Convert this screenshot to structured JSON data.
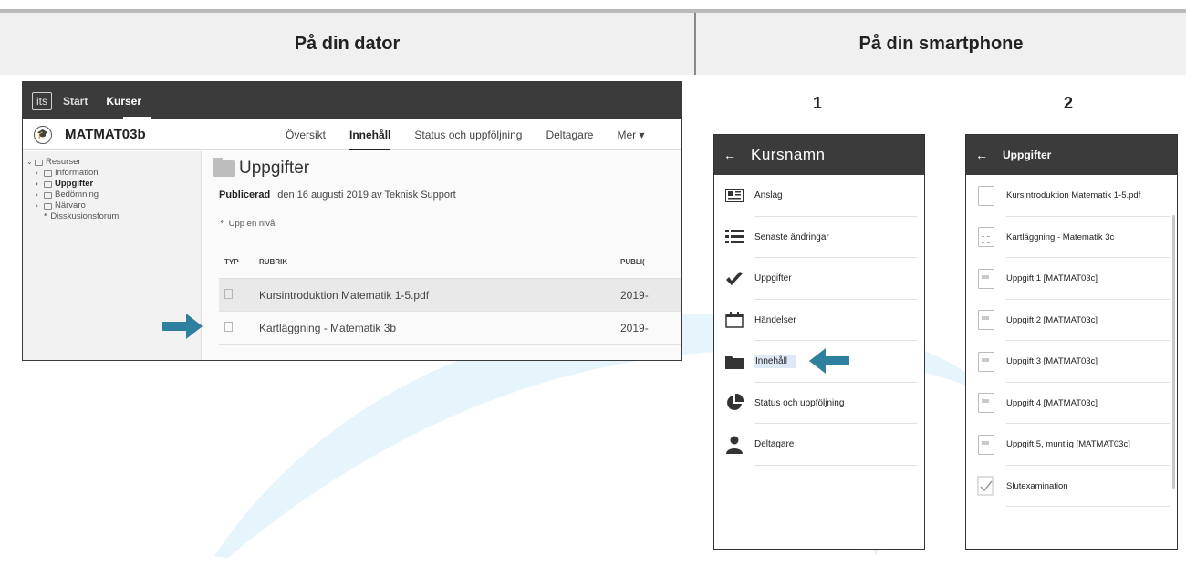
{
  "headers": {
    "left": "På din dator",
    "right": "På din smartphone"
  },
  "steps": {
    "one": "1",
    "two": "2"
  },
  "desktop": {
    "topbar": {
      "logo": "its",
      "start": "Start",
      "kurser": "Kurser"
    },
    "course": {
      "title": "MATMAT03b"
    },
    "tabs": [
      "Översikt",
      "Innehåll",
      "Status och uppföljning",
      "Deltagare",
      "Mer ▾"
    ],
    "tree": {
      "root": "Resurser",
      "items": [
        "Information",
        "Uppgifter",
        "Bedömning",
        "Närvaro"
      ],
      "forum": "Disskusionsforum"
    },
    "page_title": "Uppgifter",
    "published_label": "Publicerad",
    "published_text": "den 16 augusti 2019 av Teknisk Support",
    "up_level": "Upp en nivå",
    "table": {
      "headers": [
        "TYP",
        "RUBRIK",
        "PUBLI("
      ],
      "rows": [
        {
          "title": "Kursintroduktion Matematik 1-5.pdf",
          "published": "2019-"
        },
        {
          "title": "Kartläggning - Matematik 3b",
          "published": "2019-"
        }
      ]
    }
  },
  "phone1": {
    "back": "←",
    "title": "Kursnamn",
    "items": [
      "Anslag",
      "Senaste ändringar",
      "Uppgifter",
      "Händelser",
      "Innehåll",
      "Status och uppföljning",
      "Deltagare"
    ]
  },
  "phone2": {
    "back": "←",
    "title": "Uppgifter",
    "items": [
      "Kursintroduktion Matematik 1-5.pdf",
      "Kartläggning - Matematik 3c",
      "Uppgift 1 [MATMAT03c]",
      "Uppgift 2 [MATMAT03c]",
      "Uppgift 3 [MATMAT03c]",
      "Uppgift 4 [MATMAT03c]",
      "Uppgift 5, muntlig [MATMAT03c]",
      "Slutexamination"
    ]
  },
  "colors": {
    "arrow": "#2f7f9e",
    "swoosh": "#eaf6fc",
    "topbar": "#3b3b3b"
  }
}
